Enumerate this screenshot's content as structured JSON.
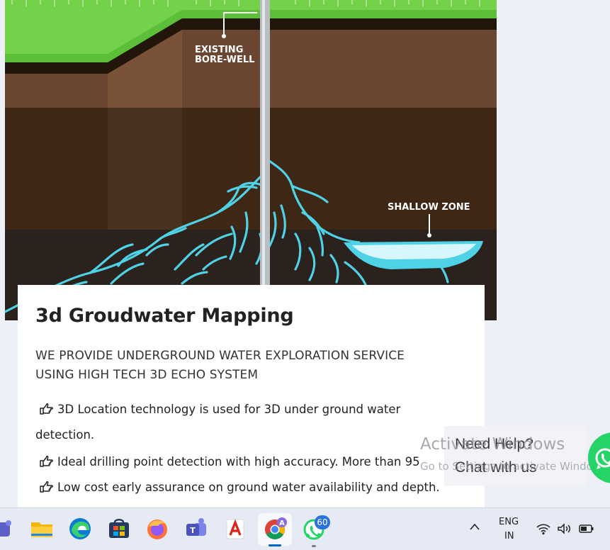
{
  "illustration": {
    "label_existing_line1": "EXISTING",
    "label_existing_line2": "BORE-WELL",
    "label_shallow": "SHALLOW ZONE"
  },
  "card": {
    "title": "3d Groudwater Mapping",
    "subtitle_line1": "WE PROVIDE UNDERGROUND WATER EXPLORATION SERVICE",
    "subtitle_line2": "USING HIGH TECH 3D ECHO SYSTEM",
    "bullets": [
      "3D Location technology is used for 3D under ground water",
      "detection.",
      "Ideal drilling point detection with high accuracy. More than 95",
      "Low cost early assurance on ground water availability and depth."
    ]
  },
  "watermark": {
    "line1": "Activate Windows",
    "line2": "Go to Settings to activate Windows."
  },
  "help_widget": {
    "line1": "Need Help?",
    "line2": "Chat with us"
  },
  "taskbar": {
    "whatsapp_badge": "60",
    "lang_line1": "ENG",
    "lang_line2": "IN",
    "overflow_caret": "^",
    "apps": [
      "teams-icon",
      "file-explorer-icon",
      "edge-icon",
      "store-icon",
      "firefox-icon",
      "teams-work-icon",
      "acrobat-icon",
      "chrome-icon",
      "whatsapp-icon"
    ]
  },
  "colors": {
    "grass": "#5cbf3a",
    "soil_top": "#6b4630",
    "soil_mid": "#3e2815",
    "soil_deep": "#2b221d",
    "water": "#4fd2e6",
    "pipe": "#b9bec3",
    "whatsapp": "#25d366",
    "taskbar_badge": "#2a73d8"
  }
}
